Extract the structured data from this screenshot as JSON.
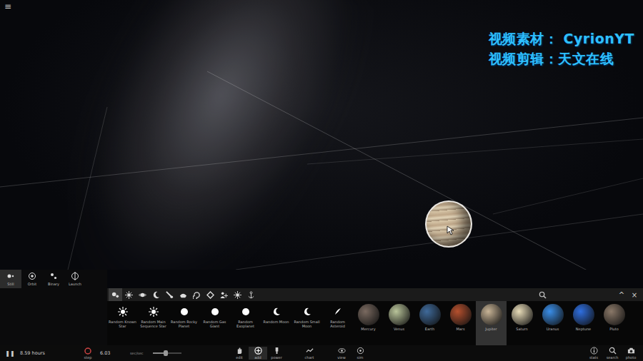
{
  "menu_icon": "≡",
  "watermark": [
    "视频素材： CyrionYT",
    "视频剪辑：天文在线"
  ],
  "mode_tabs": [
    {
      "label": "Still",
      "selected": true
    },
    {
      "label": "Orbit",
      "selected": false
    },
    {
      "label": "Binary",
      "selected": false
    },
    {
      "label": "Launch",
      "selected": false
    }
  ],
  "categories": [
    {
      "kind": "all",
      "selected": true
    },
    {
      "kind": "star",
      "selected": false
    },
    {
      "kind": "planet",
      "selected": false
    },
    {
      "kind": "moon",
      "selected": false
    },
    {
      "kind": "comet",
      "selected": false
    },
    {
      "kind": "ship",
      "selected": false
    },
    {
      "kind": "galaxy",
      "selected": false
    },
    {
      "kind": "cluster",
      "selected": false
    },
    {
      "kind": "people",
      "selected": false
    },
    {
      "kind": "sun",
      "selected": false
    },
    {
      "kind": "anchor",
      "selected": false
    }
  ],
  "panel_controls": [
    "^",
    "×"
  ],
  "items": [
    {
      "label": "Random Known Star",
      "kind": "star",
      "selected": false,
      "color": "#ffffff"
    },
    {
      "label": "Random Main Sequence Star",
      "kind": "star",
      "selected": false,
      "color": "#ffffff"
    },
    {
      "label": "Random Rocky Planet",
      "kind": "dot",
      "selected": false,
      "color": "#ffffff"
    },
    {
      "label": "Random Gas Giant",
      "kind": "dot",
      "selected": false,
      "color": "#ffffff"
    },
    {
      "label": "Random Exoplanet",
      "kind": "dot",
      "selected": false,
      "color": "#ffffff"
    },
    {
      "label": "Random Moon",
      "kind": "moon",
      "selected": false,
      "color": "#ffffff"
    },
    {
      "label": "Random Small Moon",
      "kind": "moon",
      "selected": false,
      "color": "#ffffff"
    },
    {
      "label": "Random Asteroid",
      "kind": "asteroid",
      "selected": false,
      "color": "#ffffff"
    },
    {
      "label": "Mercury",
      "kind": "planet",
      "selected": false,
      "color": "#7a6a60"
    },
    {
      "label": "Venus",
      "kind": "planet",
      "selected": false,
      "color": "#b9c49a"
    },
    {
      "label": "Earth",
      "kind": "planet",
      "selected": false,
      "color": "#3f6a9a"
    },
    {
      "label": "Mars",
      "kind": "planet",
      "selected": false,
      "color": "#b5502e"
    },
    {
      "label": "Jupiter",
      "kind": "planet",
      "selected": true,
      "color": "#c8b496"
    },
    {
      "label": "Saturn",
      "kind": "planet",
      "selected": false,
      "color": "#e8dcb8"
    },
    {
      "label": "Uranus",
      "kind": "planet",
      "selected": false,
      "color": "#3a8ee8"
    },
    {
      "label": "Neptune",
      "kind": "planet",
      "selected": false,
      "color": "#2f6fe0"
    },
    {
      "label": "Pluto",
      "kind": "planet",
      "selected": false,
      "color": "#8a7868"
    }
  ],
  "bottom_bar": {
    "pause": "❚❚",
    "time": "8.59 hours",
    "step": "step",
    "speed": "6.03",
    "speed_unit": "sec/sec",
    "slider_level": 0.45,
    "tools": [
      {
        "label": "edit",
        "selected": false
      },
      {
        "label": "add",
        "selected": true
      },
      {
        "label": "power",
        "selected": false
      },
      {
        "label": "chart",
        "selected": false
      },
      {
        "label": "view",
        "selected": false
      },
      {
        "label": "sim",
        "selected": false
      }
    ],
    "right": [
      "stats",
      "search",
      "photo"
    ]
  }
}
